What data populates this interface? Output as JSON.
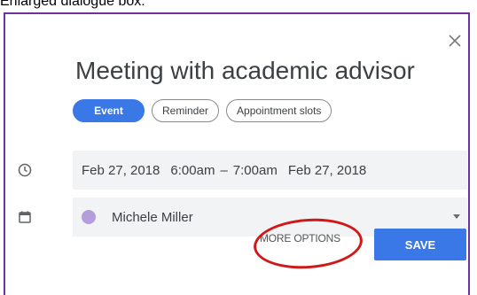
{
  "caption": "Enlarged dialogue box:",
  "dialog": {
    "title": "Meeting with academic advisor",
    "tabs": [
      {
        "label": "Event",
        "active": true
      },
      {
        "label": "Reminder",
        "active": false
      },
      {
        "label": "Appointment slots",
        "active": false
      }
    ],
    "date_row": {
      "start_date": "Feb 27, 2018",
      "start_time": "6:00am",
      "separator": "–",
      "end_time": "7:00am",
      "end_date": "Feb 27, 2018"
    },
    "calendar": {
      "name": "Michele Miller",
      "color": "#b39ddb"
    },
    "more_options_label": "MORE OPTIONS",
    "save_label": "SAVE"
  },
  "colors": {
    "accent": "#3b78e7",
    "dialog_border": "#7030a0",
    "annotation": "#d01818",
    "row_background": "#f1f3f4"
  },
  "icons": [
    "close-icon",
    "clock-icon",
    "calendar-icon",
    "dropdown-caret-icon"
  ]
}
